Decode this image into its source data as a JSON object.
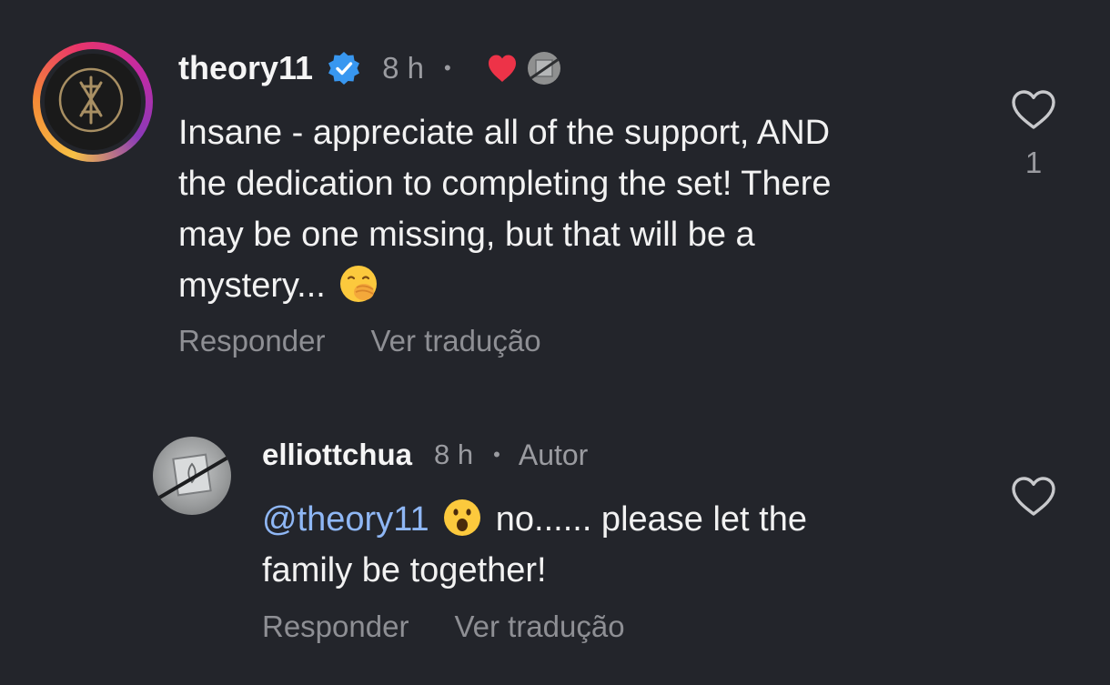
{
  "comments": [
    {
      "username": "theory11",
      "time": "8 h",
      "separator": "•",
      "text_line1": "Insane - appreciate all of the support, AND",
      "text_line2": "the dedication to completing the set! There",
      "text_line3": "may be one missing, but that will be a",
      "text_line4": "mystery...",
      "reply_label": "Responder",
      "translate_label": "Ver tradução",
      "like_count": "1",
      "icons": {
        "avatar": "theory11-logo-avatar",
        "verified": "verified-badge-icon",
        "creator_like": "red-heart-icon",
        "emoji": "hand-over-mouth-emoji",
        "like": "heart-outline-icon"
      },
      "colors": {
        "verified": "#3897f0",
        "heart": "#ed3348"
      }
    },
    {
      "username": "elliottchua",
      "time": "8 h",
      "separator": "•",
      "author_badge": "Autor",
      "mention": "@theory11",
      "text_after_emoji": "no...... please let the",
      "text_line2": "family be together!",
      "reply_label": "Responder",
      "translate_label": "Ver tradução",
      "icons": {
        "avatar": "card-box-avatar",
        "emoji": "surprised-face-emoji",
        "like": "heart-outline-icon"
      },
      "colors": {
        "mention": "#8fb7f5"
      }
    }
  ]
}
